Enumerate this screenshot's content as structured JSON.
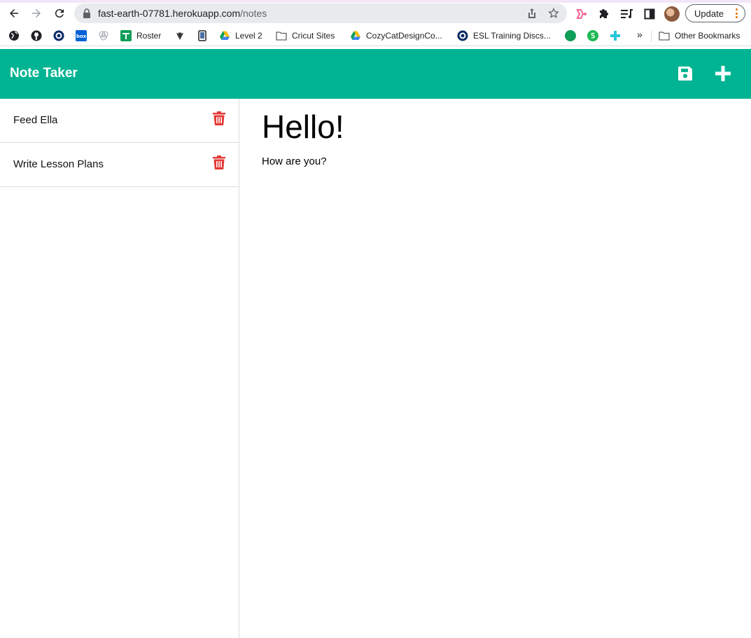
{
  "browser": {
    "url_host": "fast-earth-07781.herokuapp.com",
    "url_path": "/notes",
    "update_label": "Update",
    "bookmarks": [
      {
        "label": "Roster"
      },
      {
        "label": "Level 2"
      },
      {
        "label": "Cricut Sites"
      },
      {
        "label": "CozyCatDesignCo..."
      },
      {
        "label": "ESL Training Discs..."
      },
      {
        "label": "Other Bookmarks"
      }
    ],
    "overflow_label": "»"
  },
  "app": {
    "title": "Note Taker",
    "accent_color": "#00b493",
    "delete_color": "#e53935"
  },
  "notes": [
    {
      "title": "Feed Ella"
    },
    {
      "title": "Write Lesson Plans"
    }
  ],
  "active_note": {
    "title": "Hello!",
    "text": "How are you?"
  }
}
